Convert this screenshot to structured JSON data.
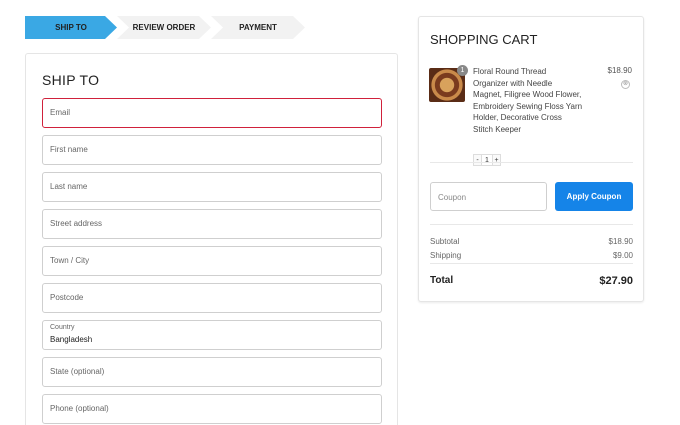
{
  "steps": [
    {
      "label": "SHIP TO"
    },
    {
      "label": "REVIEW ORDER"
    },
    {
      "label": "PAYMENT"
    }
  ],
  "ship": {
    "title": "SHIP TO",
    "email_placeholder": "Email",
    "first_name_placeholder": "First name",
    "last_name_placeholder": "Last name",
    "street_placeholder": "Street address",
    "town_placeholder": "Town / City",
    "postcode_placeholder": "Postcode",
    "country_label": "Country",
    "country_value": "Bangladesh",
    "state_placeholder": "State (optional)",
    "phone_placeholder": "Phone (optional)"
  },
  "cart": {
    "title": "SHOPPING CART",
    "item": {
      "qty_badge": "1",
      "name": "Floral Round Thread Organizer with Needle Magnet, Filigree Wood Flower, Embroidery Sewing Floss Yarn Holder, Decorative Cross Stitch Keeper",
      "price": "$18.90",
      "remove_glyph": "⊗",
      "minus": "-",
      "quantity": "1",
      "plus": "+"
    },
    "coupon_placeholder": "Coupon",
    "apply_label": "Apply Coupon",
    "subtotal_label": "Subtotal",
    "subtotal_value": "$18.90",
    "shipping_label": "Shipping",
    "shipping_value": "$9.00",
    "total_label": "Total",
    "total_value": "$27.90"
  },
  "colors": {
    "active_step": "#3aa8e4",
    "apply_button": "#1584e8",
    "error_border": "#d0213b"
  }
}
